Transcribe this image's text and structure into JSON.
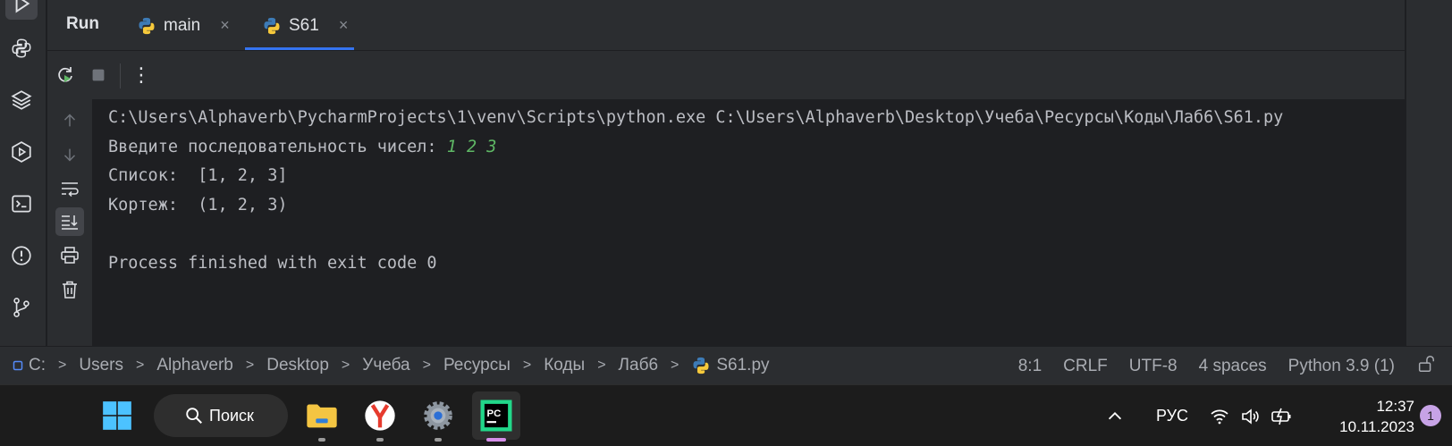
{
  "tool_window": {
    "title": "Run",
    "tabs": [
      {
        "label": "main",
        "close": "×"
      },
      {
        "label": "S61",
        "close": "×"
      }
    ]
  },
  "toolbar": {
    "more": "⋮"
  },
  "console": {
    "command": "C:\\Users\\Alphaverb\\PycharmProjects\\1\\venv\\Scripts\\python.exe C:\\Users\\Alphaverb\\Desktop\\Учеба\\Ресурсы\\Коды\\Лаб6\\S61.py",
    "prompt": "Введите последовательность чисел: ",
    "user_input": "1 2 3",
    "list_output": "Список:  [1, 2, 3]",
    "tuple_output": "Кортеж:  (1, 2, 3)",
    "blank": "",
    "exit_message": "Process finished with exit code 0"
  },
  "breadcrumb": {
    "items": [
      "C:",
      "Users",
      "Alphaverb",
      "Desktop",
      "Учеба",
      "Ресурсы",
      "Коды",
      "Лаб6",
      "S61.py"
    ]
  },
  "status": {
    "position": "8:1",
    "line_ending": "CRLF",
    "encoding": "UTF-8",
    "indent": "4 spaces",
    "interpreter": "Python 3.9 (1)"
  },
  "taskbar": {
    "search_label": "Поиск",
    "language": "РУС",
    "time": "12:37",
    "date": "10.11.2023",
    "notification_count": "1"
  },
  "colors": {
    "accent": "#3574f0",
    "input_text": "#5fb865",
    "pycharm_badge": "#21d789"
  }
}
